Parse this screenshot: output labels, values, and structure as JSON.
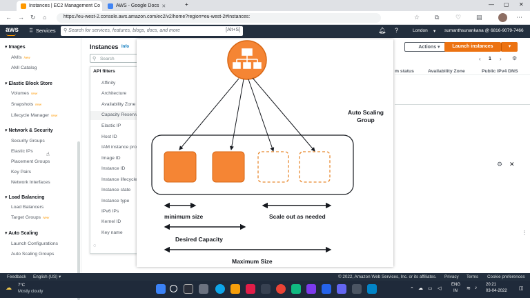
{
  "browser": {
    "tabs": [
      {
        "label": "Instances | EC2 Management Co"
      },
      {
        "label": "AWS - Google Docs"
      }
    ],
    "url": "https://eu-west-2.console.aws.amazon.com/ec2/v2/home?region=eu-west-2#Instances:"
  },
  "aws_header": {
    "logo": "aws",
    "services_label": "Services",
    "search_placeholder": "Search for services, features, blogs, docs, and more",
    "search_shortcut": "[Alt+S]",
    "region": "London",
    "account": "sumanthsunankana @ 6816-9079-7466"
  },
  "sidebar": {
    "sections": [
      {
        "title": "Images",
        "items": [
          {
            "label": "AMIs",
            "badge": "New"
          },
          {
            "label": "AMI Catalog",
            "badge": ""
          }
        ]
      },
      {
        "title": "Elastic Block Store",
        "items": [
          {
            "label": "Volumes",
            "badge": "New"
          },
          {
            "label": "Snapshots",
            "badge": "New"
          },
          {
            "label": "Lifecycle Manager",
            "badge": "New"
          }
        ]
      },
      {
        "title": "Network & Security",
        "items": [
          {
            "label": "Security Groups",
            "badge": ""
          },
          {
            "label": "Elastic IPs",
            "badge": ""
          },
          {
            "label": "Placement Groups",
            "badge": ""
          },
          {
            "label": "Key Pairs",
            "badge": ""
          },
          {
            "label": "Network Interfaces",
            "badge": ""
          }
        ]
      },
      {
        "title": "Load Balancing",
        "items": [
          {
            "label": "Load Balancers",
            "badge": ""
          },
          {
            "label": "Target Groups",
            "badge": "New"
          }
        ]
      },
      {
        "title": "Auto Scaling",
        "items": [
          {
            "label": "Launch Configurations",
            "badge": ""
          },
          {
            "label": "Auto Scaling Groups",
            "badge": ""
          }
        ]
      }
    ]
  },
  "main": {
    "title": "Instances",
    "info": "Info",
    "search_placeholder": "Search",
    "actions_label": "Actions",
    "launch_label": "Launch instances",
    "page_number": "1",
    "columns": [
      "m status",
      "Availability Zone",
      "Public IPv4 DNS"
    ]
  },
  "filter_dropdown": {
    "header": "API filters",
    "items": [
      "Affinity",
      "Architecture",
      "Availability Zone",
      "Capacity Reservation",
      "Elastic IP",
      "Host ID",
      "IAM instance profile",
      "Image ID",
      "Instance ID",
      "Instance lifecycle",
      "Instance state",
      "Instance type",
      "IPv6 IPs",
      "Kernel ID",
      "Key name"
    ]
  },
  "diagram": {
    "group_label": "Auto Scaling Group",
    "min_label": "minimum size",
    "scale_label": "Scale out as needed",
    "desired_label": "Desired Capacity",
    "max_label": "Maximum Size",
    "colors": {
      "instance": "#f58534",
      "instance_border": "#d86613",
      "root": "#f58534"
    }
  },
  "footer": {
    "feedback": "Feedback",
    "language": "English (US)",
    "copyright": "© 2022, Amazon Web Services, Inc. or its affiliates.",
    "privacy": "Privacy",
    "terms": "Terms",
    "cookies": "Cookie preferences"
  },
  "taskbar": {
    "weather_temp": "7°C",
    "weather_desc": "Mostly cloudy",
    "lang": "ENG",
    "region": "IN",
    "time": "20:21",
    "date": "03-04-2022"
  }
}
